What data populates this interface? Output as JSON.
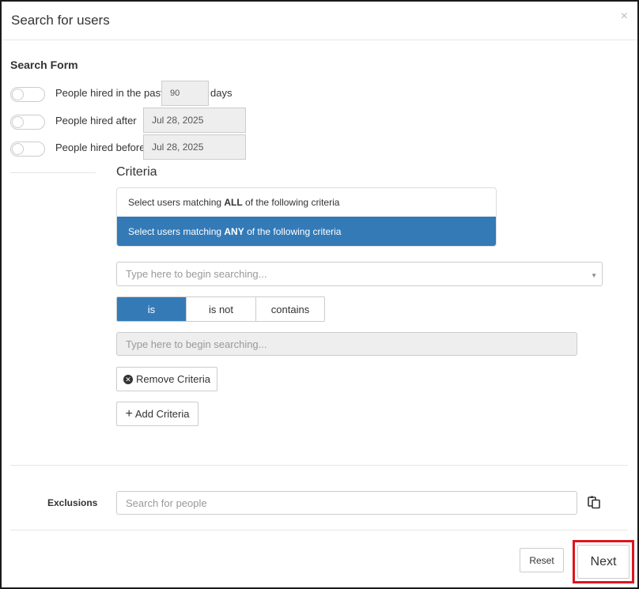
{
  "header": {
    "title": "Search for users",
    "close_glyph": "×"
  },
  "form": {
    "section_title": "Search Form",
    "hired_past": {
      "label": "People hired in the past",
      "value": "90",
      "suffix": "days"
    },
    "hired_after": {
      "label": "People hired after",
      "value": "Jul 28, 2025"
    },
    "hired_before": {
      "label": "People hired before",
      "value": "Jul 28, 2025"
    }
  },
  "criteria": {
    "title": "Criteria",
    "match_all": {
      "prefix": "Select users matching ",
      "strong": "ALL",
      "suffix": " of the following criteria"
    },
    "match_any": {
      "prefix": "Select users matching ",
      "strong": "ANY",
      "suffix": " of the following criteria"
    },
    "attribute_placeholder": "Type here to begin searching...",
    "operators": [
      "is",
      "is not",
      "contains"
    ],
    "selected_operator": "is",
    "value_placeholder": "Type here to begin searching...",
    "remove_label": "Remove Criteria",
    "add_label": "Add Criteria"
  },
  "exclusions": {
    "label": "Exclusions",
    "placeholder": "Search for people"
  },
  "footer": {
    "reset_label": "Reset",
    "next_label": "Next"
  },
  "colors": {
    "accent": "#337ab7",
    "highlight": "#e0141e"
  }
}
